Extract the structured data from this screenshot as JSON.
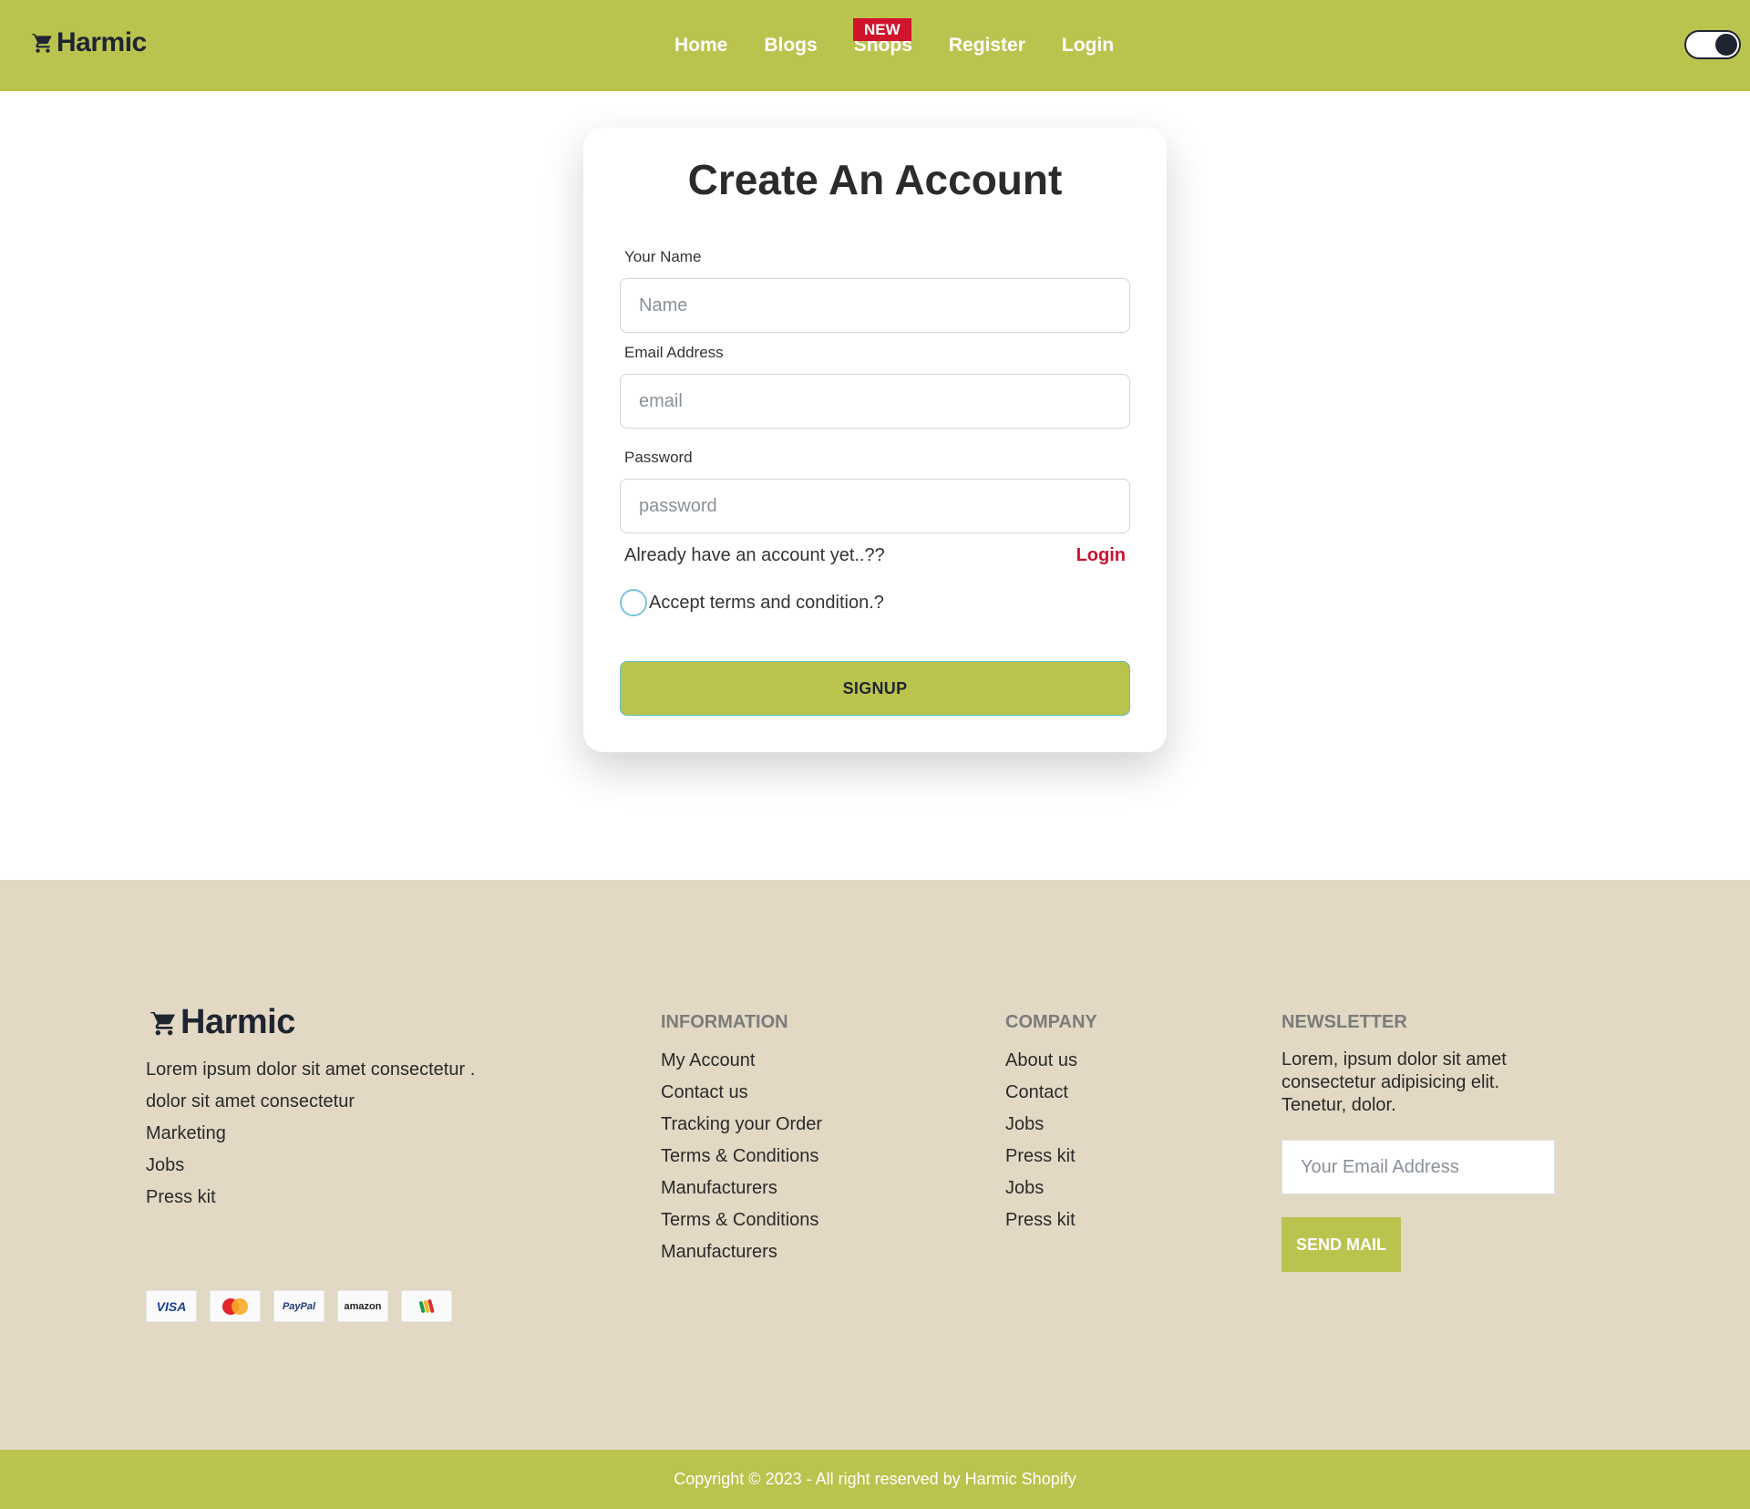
{
  "nav": {
    "brand": "Harmic",
    "links": [
      "Home",
      "Blogs",
      "Shops",
      "Register",
      "Login"
    ],
    "badge": "NEW"
  },
  "form": {
    "title": "Create An Account",
    "name_label": "Your Name",
    "name_placeholder": "Name",
    "email_label": "Email Address",
    "email_placeholder": "email",
    "password_label": "Password",
    "password_placeholder": "password",
    "already_text": "Already have an account yet..??",
    "login_link": "Login",
    "terms_label": "Accept terms and condition.?",
    "signup_label": "SIGNUP"
  },
  "footer": {
    "brand": "Harmic",
    "about_lines": [
      "Lorem ipsum dolor sit amet consectetur .",
      "dolor sit amet consectetur",
      "Marketing",
      "Jobs",
      "Press kit"
    ],
    "information": {
      "heading": "INFORMATION",
      "links": [
        "My Account",
        "Contact us",
        "Tracking your Order",
        "Terms & Conditions",
        "Manufacturers",
        "Terms & Conditions",
        "Manufacturers"
      ]
    },
    "company": {
      "heading": "COMPANY",
      "links": [
        "About us",
        "Contact",
        "Jobs",
        "Press kit",
        "Jobs",
        "Press kit"
      ]
    },
    "newsletter": {
      "heading": "NEWSLETTER",
      "text": "Lorem, ipsum dolor sit amet consectetur adipisicing elit. Tenetur, dolor.",
      "placeholder": "Your Email Address",
      "button": "SEND MAIL"
    },
    "payment_icons": [
      "visa-icon",
      "mastercard-icon",
      "paypal-icon",
      "amazon-icon",
      "google-wallet-icon"
    ],
    "payment_labels": {
      "visa": "VISA",
      "paypal": "PayPal",
      "amazon": "amazon"
    }
  },
  "copyright": "Copyright © 2023 - All right reserved by Harmic Shopify",
  "colors": {
    "accent": "#bbc34f",
    "footer_bg": "#e2d8c4",
    "badge": "#d0142c",
    "login_link": "#cc1230"
  }
}
